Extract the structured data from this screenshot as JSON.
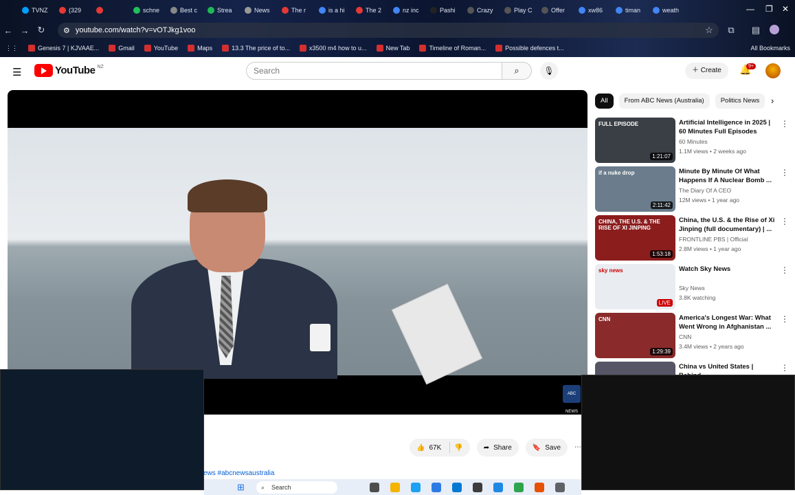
{
  "browser": {
    "tabs": [
      {
        "label": "TVNZ"
      },
      {
        "label": "(329"
      },
      {
        "label": ""
      },
      {
        "label": "schne"
      },
      {
        "label": "Best c"
      },
      {
        "label": "Strea"
      },
      {
        "label": "News"
      },
      {
        "label": "The r"
      },
      {
        "label": "is a hi"
      },
      {
        "label": "The 2"
      },
      {
        "label": "nz inc"
      },
      {
        "label": "Pashi"
      },
      {
        "label": "Crazy"
      },
      {
        "label": "Play C"
      },
      {
        "label": "Offer"
      },
      {
        "label": "xw86"
      },
      {
        "label": "timan"
      },
      {
        "label": "weath"
      }
    ],
    "url": "youtube.com/watch?v=vOTJkg1voo",
    "bookmarks": [
      "Genesis 7 | KJVAAE...",
      "Gmail",
      "YouTube",
      "Maps",
      "13.3 The price of to...",
      "x3500 m4 how to u...",
      "New Tab",
      "Timeline of Roman...",
      "Possible defences t..."
    ],
    "all_bookmarks": "All Bookmarks"
  },
  "youtube": {
    "logo_word": "YouTube",
    "country_code": "NZ",
    "search_placeholder": "Search",
    "create_label": "Create",
    "notification_count": "9+"
  },
  "video": {
    "like_count": "67K",
    "share_label": "Share",
    "save_label": "Save",
    "hashtag_text": "ews #abcnewsaustralia",
    "broadcaster_badge": "ABC NEWS"
  },
  "chips": [
    "All",
    "From ABC News (Australia)",
    "Politics News"
  ],
  "recommendations": [
    {
      "title": "Artificial Intelligence in 2025 | 60 Minutes Full Episodes",
      "channel": "60 Minutes",
      "meta": "1.1M views • 2 weeks ago",
      "duration": "1:21:07",
      "thumb_color": "#3a3f45",
      "overlay": "FULL EPISODE"
    },
    {
      "title": "Minute By Minute Of What Happens If A Nuclear Bomb ...",
      "channel": "The Diary Of A CEO",
      "meta": "12M views • 1 year ago",
      "duration": "2:11:42",
      "thumb_color": "#6b7d8c",
      "overlay": "if a nuke drop"
    },
    {
      "title": "China, the U.S. & the Rise of Xi Jinping (full documentary) | ...",
      "channel": "FRONTLINE PBS | Official",
      "meta": "2.8M views • 1 year ago",
      "duration": "1:53:18",
      "thumb_color": "#8c1d1d",
      "overlay": "CHINA, THE U.S. & THE RISE OF XI JINPING"
    },
    {
      "title": "Watch Sky News",
      "channel": "Sky News",
      "meta": "3.8K watching",
      "duration": "LIVE",
      "thumb_color": "#e9ecf1",
      "overlay": "sky news"
    },
    {
      "title": "America's Longest War: What Went Wrong in Afghanistan ...",
      "channel": "CNN",
      "meta": "3.4M views • 2 years ago",
      "duration": "1:29:39",
      "thumb_color": "#8a2a2a",
      "overlay": "CNN"
    },
    {
      "title": "China vs United States | Behind",
      "channel": "",
      "meta": "",
      "duration": "",
      "thumb_color": "#556",
      "overlay": ""
    }
  ],
  "taskbar": {
    "search_label": "Search"
  }
}
